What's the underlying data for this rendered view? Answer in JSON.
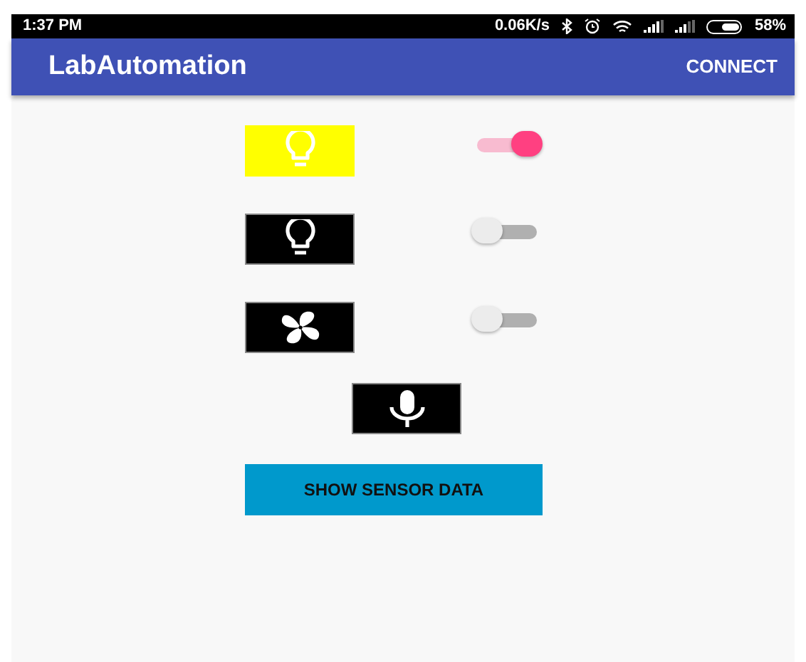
{
  "status_bar": {
    "time": "1:37 PM",
    "speed": "0.06K/s",
    "battery": "58%"
  },
  "app_bar": {
    "title": "LabAutomation",
    "action": "CONNECT"
  },
  "devices": [
    {
      "kind": "bulb",
      "on": true
    },
    {
      "kind": "bulb",
      "on": false
    },
    {
      "kind": "fan",
      "on": false
    }
  ],
  "mic": {
    "kind": "mic"
  },
  "button": "SHOW SENSOR DATA"
}
